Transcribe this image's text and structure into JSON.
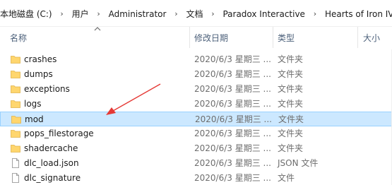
{
  "breadcrumb": {
    "items": [
      "本地磁盘 (C:)",
      "用户",
      "Administrator",
      "文档",
      "Paradox Interactive",
      "Hearts of Iron IV"
    ],
    "separator": "›"
  },
  "columns": {
    "name": "名称",
    "date": "修改日期",
    "type": "类型",
    "size": "大小"
  },
  "files": [
    {
      "name": "crashes",
      "date": "2020/6/3 星期三 ...",
      "type": "文件夹",
      "kind": "folder"
    },
    {
      "name": "dumps",
      "date": "2020/6/3 星期三 ...",
      "type": "文件夹",
      "kind": "folder"
    },
    {
      "name": "exceptions",
      "date": "2020/6/3 星期三 ...",
      "type": "文件夹",
      "kind": "folder"
    },
    {
      "name": "logs",
      "date": "2020/6/3 星期三 ...",
      "type": "文件夹",
      "kind": "folder"
    },
    {
      "name": "mod",
      "date": "2020/6/3 星期三 ...",
      "type": "文件夹",
      "kind": "folder",
      "selected": true
    },
    {
      "name": "pops_filestorage",
      "date": "2020/6/3 星期三 ...",
      "type": "文件夹",
      "kind": "folder"
    },
    {
      "name": "shadercache",
      "date": "2020/6/3 星期三 ...",
      "type": "文件夹",
      "kind": "folder"
    },
    {
      "name": "dlc_load.json",
      "date": "2020/6/3 星期三 ...",
      "type": "JSON 文件",
      "kind": "file"
    },
    {
      "name": "dlc_signature",
      "date": "2020/6/3 星期三 ...",
      "type": "文件",
      "kind": "file"
    }
  ],
  "colors": {
    "selection_bg": "#cce8ff",
    "selection_border": "#99d1ff",
    "folder": "#ffd66e",
    "annotation_arrow": "#e53935"
  }
}
